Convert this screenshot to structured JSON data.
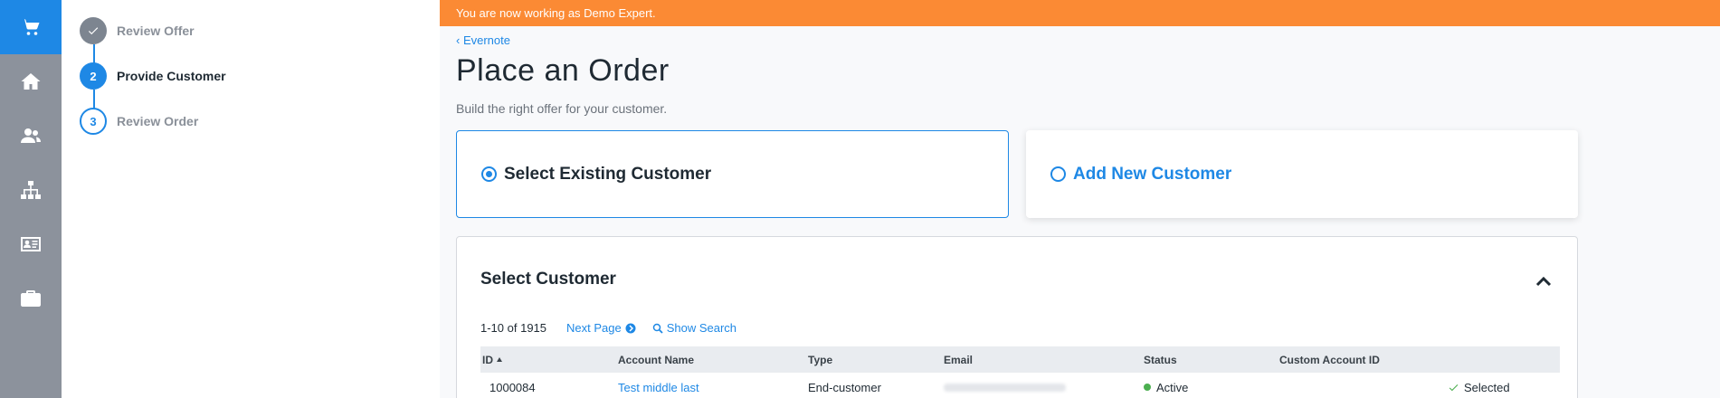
{
  "colors": {
    "accent": "#1e88e5",
    "banner": "#fb8a34",
    "rail": "#8c929c",
    "status_active": "#4caf50",
    "selected_check": "#4caf50"
  },
  "rail": {
    "items": [
      {
        "icon": "cart-icon",
        "active": true
      },
      {
        "icon": "home-icon",
        "active": false
      },
      {
        "icon": "users-icon",
        "active": false
      },
      {
        "icon": "sitemap-icon",
        "active": false
      },
      {
        "icon": "id-card-icon",
        "active": false
      },
      {
        "icon": "briefcase-icon",
        "active": false
      }
    ]
  },
  "stepper": {
    "steps": [
      {
        "marker": "check-icon",
        "label": "Review Offer",
        "state": "done"
      },
      {
        "marker": "2",
        "label": "Provide Customer",
        "state": "current"
      },
      {
        "marker": "3",
        "label": "Review Order",
        "state": "todo"
      }
    ]
  },
  "banner": {
    "text": "You are now working as Demo Expert."
  },
  "header": {
    "back_label": "‹ Evernote",
    "title": "Place an Order",
    "subtitle": "Build the right offer for your customer."
  },
  "options": {
    "existing_label": "Select Existing Customer",
    "new_label": "Add New Customer",
    "selected": "existing"
  },
  "customer_panel": {
    "title": "Select Customer",
    "count": "1-10 of 1915",
    "next_page": "Next Page",
    "show_search": "Show Search",
    "columns": [
      "ID",
      "Account Name",
      "Type",
      "Email",
      "Status",
      "Custom Account ID"
    ],
    "sort_column": "ID",
    "sort_direction": "ascending",
    "rows": [
      {
        "id": "1000084",
        "account_name": "Test middle last",
        "type": "End-customer",
        "email": "",
        "status": "Active",
        "custom_id": "",
        "selected_label": "Selected"
      }
    ]
  }
}
